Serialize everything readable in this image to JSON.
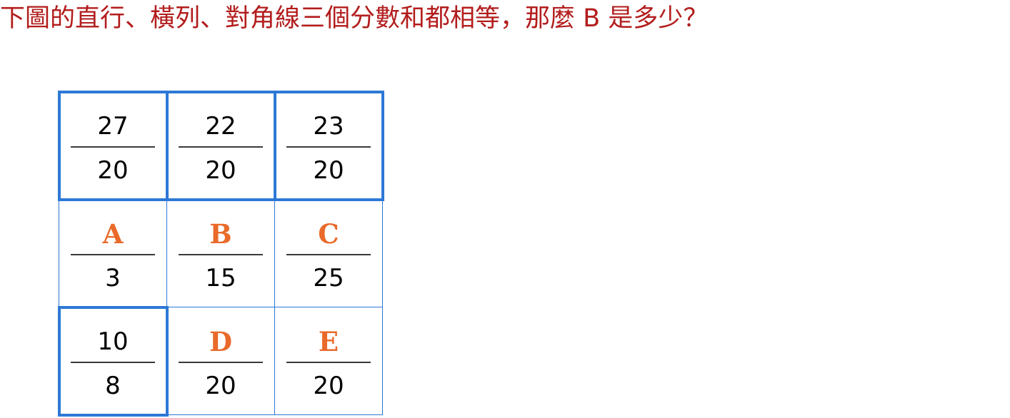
{
  "question": "下圖的直行、橫列、對角線三個分數和都相等，那麼 B 是多少？",
  "colors": {
    "question_text": "#b31d1d",
    "grid_line": "#2d78d6",
    "unknown_letter": "#e96a2a",
    "fraction_text": "#000000"
  },
  "grid": {
    "rows": [
      [
        {
          "numerator": "27",
          "denominator": "20",
          "unknown": false,
          "highlighted": true
        },
        {
          "numerator": "22",
          "denominator": "20",
          "unknown": false,
          "highlighted": true
        },
        {
          "numerator": "23",
          "denominator": "20",
          "unknown": false,
          "highlighted": true
        }
      ],
      [
        {
          "numerator": "A",
          "denominator": "3",
          "unknown": true,
          "highlighted": false
        },
        {
          "numerator": "B",
          "denominator": "15",
          "unknown": true,
          "highlighted": false
        },
        {
          "numerator": "C",
          "denominator": "25",
          "unknown": true,
          "highlighted": false
        }
      ],
      [
        {
          "numerator": "10",
          "denominator": "8",
          "unknown": false,
          "highlighted": true
        },
        {
          "numerator": "D",
          "denominator": "20",
          "unknown": true,
          "highlighted": false
        },
        {
          "numerator": "E",
          "denominator": "20",
          "unknown": true,
          "highlighted": false
        }
      ]
    ]
  }
}
